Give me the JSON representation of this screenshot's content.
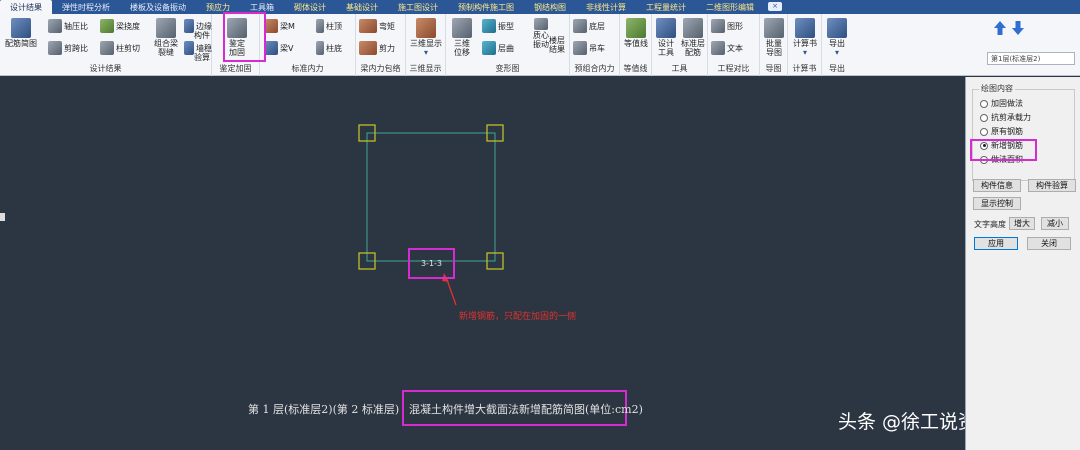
{
  "tabs": [
    {
      "label": "设计结果",
      "active": true,
      "hl": false
    },
    {
      "label": "弹性时程分析",
      "active": false,
      "hl": false
    },
    {
      "label": "楼板及设备振动",
      "active": false,
      "hl": false
    },
    {
      "label": "预应力",
      "active": false,
      "hl": true
    },
    {
      "label": "工具箱",
      "active": false,
      "hl": false
    },
    {
      "label": "砌体设计",
      "active": false,
      "hl": true
    },
    {
      "label": "基础设计",
      "active": false,
      "hl": true
    },
    {
      "label": "施工图设计",
      "active": false,
      "hl": true
    },
    {
      "label": "预制构件施工图",
      "active": false,
      "hl": true
    },
    {
      "label": "钢结构图",
      "active": false,
      "hl": true
    },
    {
      "label": "非线性计算",
      "active": false,
      "hl": true
    },
    {
      "label": "工程量统计",
      "active": false,
      "hl": true
    },
    {
      "label": "二维图形编辑",
      "active": false,
      "hl": true
    }
  ],
  "ribbon": {
    "groups": {
      "design_results": "设计结果",
      "strengthen": "鉴定加固",
      "std_internal_force": "标准内力",
      "beam_envelope": "梁内力包络",
      "view3d": "三维显示",
      "deformation": "变形图",
      "precast": "预组合内力",
      "contour": "等值线",
      "tools": "工具",
      "compare": "工程对比",
      "export_drawing": "导图",
      "calc_book": "计算书",
      "export": "导出"
    },
    "buttons": {
      "rebar_diagram": "配筋简图",
      "axial_ratio": "轴压比",
      "shear_span": "剪跨比",
      "beam_deflection": "梁挠度",
      "column_shear_comp": "柱剪切",
      "combined_beam": "组合梁",
      "crack": "裂缝",
      "edge_member": "边缘",
      "member": "构件",
      "wall_stable": "墙稳",
      "check": "验算",
      "strengthen_line1": "鉴定",
      "strengthen_line2": "加固",
      "beam_m": "梁M",
      "beam_v": "梁V",
      "col_top": "柱顶",
      "col_base": "柱底",
      "bending": "弯矩",
      "shear": "剪力",
      "view3d": "三维显示",
      "view3d_pos_line1": "三维",
      "view3d_pos_line2": "位移",
      "vibration": "振型",
      "floor_curve": "层曲",
      "torsion_line1": "质心",
      "torsion_line2": "振动",
      "floor_result_line1": "楼层",
      "floor_result_line2": "结果",
      "base": "底层",
      "crane": "吊车",
      "contour": "等值线",
      "design_tool_line1": "设计",
      "design_tool_line2": "工具",
      "std_layer_line1": "标准层",
      "std_layer_line2": "配筋",
      "shape": "图形",
      "text": "文本",
      "batch_line1": "批量",
      "batch_line2": "导图",
      "calc_book": "计算书",
      "export": "导出"
    }
  },
  "floor_select": "第1层(标准层2)",
  "drawing": {
    "label": "3-1-3",
    "annotation": "新增钢筋，只配在加固的一侧",
    "caption_prefix": "第 1 层(标准层2)(第 2 标准层)",
    "caption_main": "混凝土构件增大截面法新增配筋简图(单位:cm2)"
  },
  "panel": {
    "legend": "绘图内容",
    "options": [
      {
        "label": "加固做法",
        "selected": false
      },
      {
        "label": "抗剪承载力",
        "selected": false
      },
      {
        "label": "原有钢筋",
        "selected": false
      },
      {
        "label": "新增钢筋",
        "selected": true
      },
      {
        "label": "做法面积",
        "selected": false
      }
    ],
    "member_info": "构件信息",
    "member_check": "构件验算",
    "display_control": "显示控制",
    "text_height": "文字高度",
    "increase": "增大",
    "decrease": "减小",
    "apply": "应用",
    "close": "关闭"
  },
  "watermark": "头条 @徐工说资质",
  "colors": {
    "canvas_bg": "#2c3542",
    "column_outline": "#c8c828",
    "beam_line": "#3fa88f",
    "highlight": "#d62bd1",
    "annotation": "#e0342c"
  }
}
